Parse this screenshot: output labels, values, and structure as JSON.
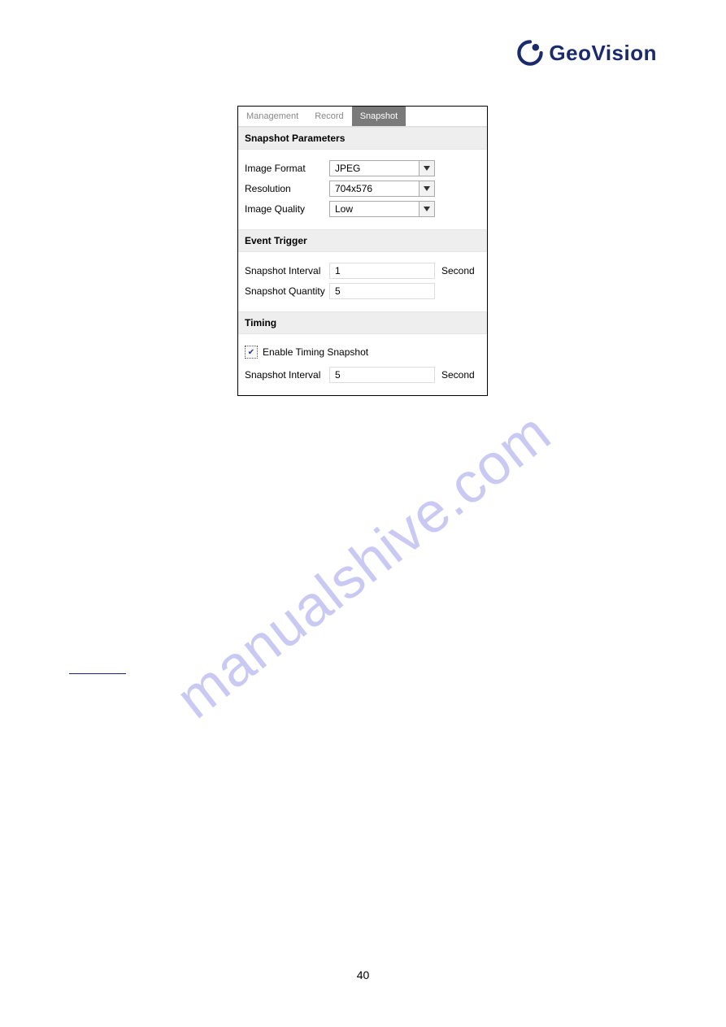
{
  "logo": {
    "text": "GeoVision"
  },
  "panel": {
    "tabs": [
      {
        "label": "Management",
        "active": false
      },
      {
        "label": "Record",
        "active": false
      },
      {
        "label": "Snapshot",
        "active": true
      }
    ],
    "snapshot_parameters": {
      "title": "Snapshot Parameters",
      "image_format": {
        "label": "Image Format",
        "value": "JPEG"
      },
      "resolution": {
        "label": "Resolution",
        "value": "704x576"
      },
      "image_quality": {
        "label": "Image Quality",
        "value": "Low"
      }
    },
    "event_trigger": {
      "title": "Event Trigger",
      "snapshot_interval": {
        "label": "Snapshot Interval",
        "value": "1",
        "unit": "Second"
      },
      "snapshot_quantity": {
        "label": "Snapshot Quantity",
        "value": "5"
      }
    },
    "timing": {
      "title": "Timing",
      "enable_label": "Enable Timing Snapshot",
      "enable_checked": true,
      "snapshot_interval": {
        "label": "Snapshot Interval",
        "value": "5",
        "unit": "Second"
      }
    }
  },
  "watermark": "manualshive.com",
  "page_number": "40"
}
